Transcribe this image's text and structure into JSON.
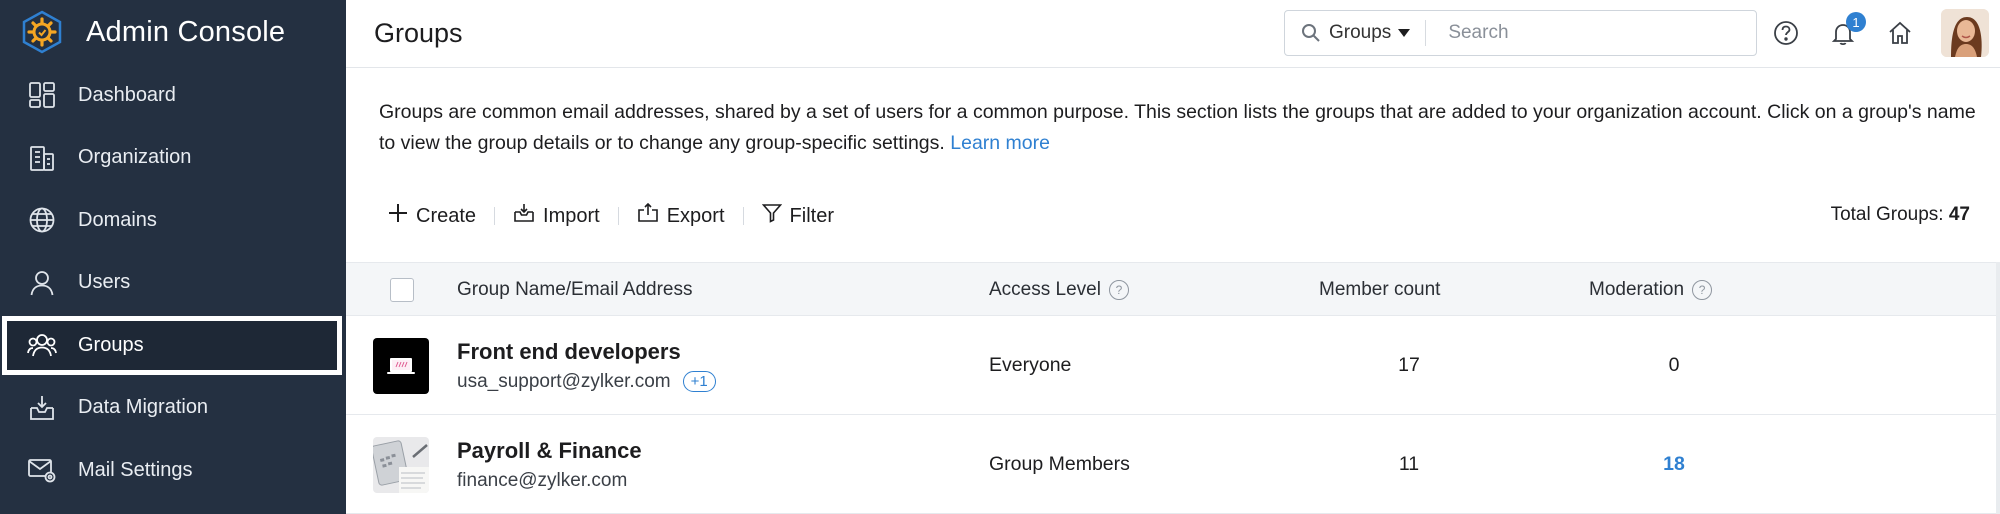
{
  "app": {
    "title": "Admin Console"
  },
  "sidebar": {
    "items": [
      {
        "label": "Dashboard",
        "icon": "dashboard-icon"
      },
      {
        "label": "Organization",
        "icon": "building-icon"
      },
      {
        "label": "Domains",
        "icon": "globe-icon"
      },
      {
        "label": "Users",
        "icon": "user-icon"
      },
      {
        "label": "Groups",
        "icon": "group-icon",
        "active": true
      },
      {
        "label": "Data Migration",
        "icon": "inbox-download-icon"
      },
      {
        "label": "Mail Settings",
        "icon": "mail-settings-icon"
      }
    ]
  },
  "header": {
    "page_title": "Groups",
    "search": {
      "scope": "Groups",
      "placeholder": "Search"
    },
    "notifications_count": "1"
  },
  "description": {
    "text": "Groups are common email addresses, shared by a set of users for a common purpose. This section lists the groups that are added to your organization account. Click on a group's name to view the group details or to change any group-specific settings. ",
    "link": "Learn more"
  },
  "toolbar": {
    "create": "Create",
    "import": "Import",
    "export": "Export",
    "filter": "Filter",
    "total_label": "Total Groups: ",
    "total_value": "47"
  },
  "table": {
    "columns": [
      "Group Name/Email Address",
      "Access Level",
      "Member count",
      "Moderation"
    ],
    "rows": [
      {
        "name": "Front end developers",
        "email": "usa_support@zylker.com",
        "extra": "+1",
        "access": "Everyone",
        "members": "17",
        "moderation": "0"
      },
      {
        "name": "Payroll & Finance",
        "email": "finance@zylker.com",
        "access": "Group Members",
        "members": "11",
        "moderation": "18"
      }
    ]
  },
  "colors": {
    "sidebar_bg": "#243041",
    "accent": "#2f80d1",
    "logo_orange": "#f5a623"
  }
}
